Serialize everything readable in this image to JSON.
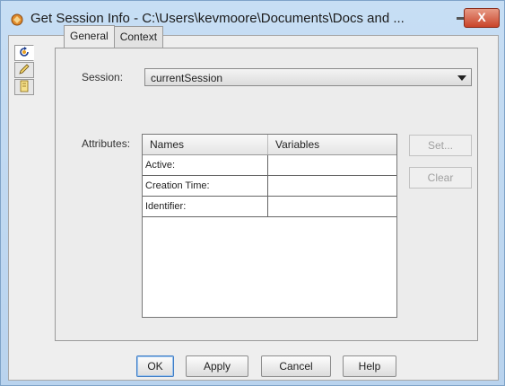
{
  "window": {
    "title": "Get Session Info - C:\\Users\\kevmoore\\Documents\\Docs and ...",
    "close_label": "X"
  },
  "side_tabs": [
    {
      "icon": "refresh-icon"
    },
    {
      "icon": "pencil-icon"
    },
    {
      "icon": "document-icon"
    }
  ],
  "tabs": [
    {
      "label": "General",
      "active": true
    },
    {
      "label": "Context",
      "active": false
    }
  ],
  "form": {
    "session_label": "Session:",
    "session_value": "currentSession",
    "attributes_label": "Attributes:"
  },
  "table": {
    "columns": [
      "Names",
      "Variables"
    ],
    "rows": [
      {
        "name": "Active:",
        "variable": ""
      },
      {
        "name": "Creation Time:",
        "variable": ""
      },
      {
        "name": "Identifier:",
        "variable": ""
      }
    ]
  },
  "side_buttons": {
    "set": "Set...",
    "clear": "Clear"
  },
  "buttons": {
    "ok": "OK",
    "apply": "Apply",
    "cancel": "Cancel",
    "help": "Help"
  }
}
